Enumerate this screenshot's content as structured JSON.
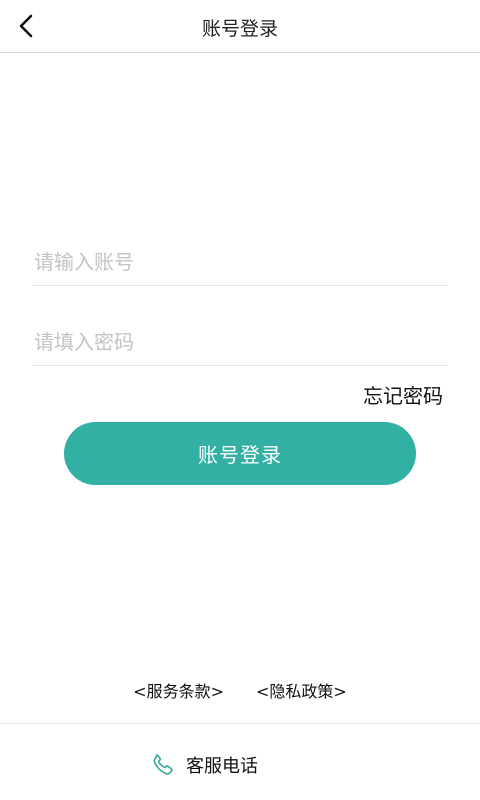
{
  "header": {
    "title": "账号登录",
    "back_icon": "chevron-left-icon"
  },
  "form": {
    "account_placeholder": "请输入账号",
    "account_value": "",
    "password_placeholder": "请填入密码",
    "password_value": "",
    "forgot_label": "忘记密码",
    "login_label": "账号登录"
  },
  "footer": {
    "terms_label": "<服务条款>",
    "privacy_label": "<隐私政策>",
    "service_label": "客服电话",
    "service_icon": "phone-icon"
  },
  "colors": {
    "accent": "#31b0a3",
    "phone_icon": "#3aa79d"
  }
}
